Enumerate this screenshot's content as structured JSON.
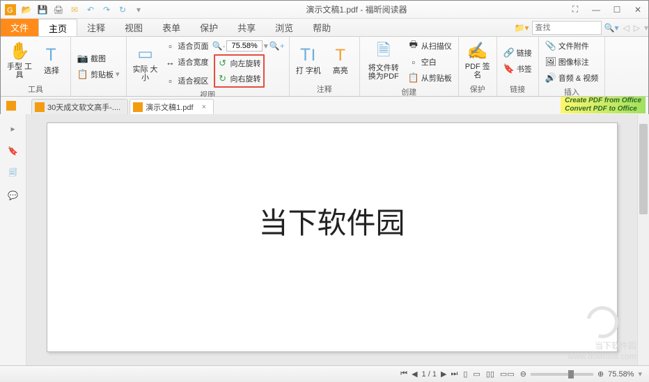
{
  "titlebar": {
    "title": "演示文稿1.pdf - 福昕阅读器"
  },
  "menu": {
    "file": "文件",
    "tabs": [
      "主页",
      "注释",
      "视图",
      "表单",
      "保护",
      "共享",
      "浏览",
      "帮助"
    ],
    "active_index": 0,
    "search_placeholder": "查找"
  },
  "ribbon": {
    "tools": {
      "hand": "手型\n工具",
      "select": "选择",
      "label": "工具"
    },
    "clipboard": {
      "snapshot": "截图",
      "paste": "剪贴板",
      "label": ""
    },
    "view": {
      "actual": "实际\n大小",
      "fitpage": "适合页面",
      "fitwidth": "适合宽度",
      "fitvis": "适合视区",
      "rotateleft": "向左旋转",
      "rotateright": "向右旋转",
      "zoom": "75.58%",
      "label": "视图"
    },
    "comment": {
      "typewriter": "打\n字机",
      "highlight": "高亮",
      "label": "注释"
    },
    "create": {
      "convert": "将文件转\n换为PDF",
      "scanner": "从扫描仪",
      "blank": "空白",
      "clipboard": "从剪贴板",
      "label": "创建"
    },
    "protect": {
      "sign": "PDF\n签名",
      "label": "保护"
    },
    "links": {
      "link": "链接",
      "bookmark": "书签",
      "label": "链接"
    },
    "insert": {
      "attach": "文件附件",
      "image": "图像标注",
      "media": "音频 & 视频",
      "label": "插入"
    }
  },
  "doctabs": [
    {
      "label": "30天成文软文高手-....",
      "active": false
    },
    {
      "label": "演示文稿1.pdf",
      "active": true
    }
  ],
  "banner": {
    "line1": "Create PDF from Office",
    "line2": "Convert PDF to Office"
  },
  "page_content": "当下软件园",
  "status": {
    "page_current": "1",
    "page_total": "1",
    "zoom": "75.58%"
  },
  "watermark": {
    "brand": "当下软件园",
    "url": "www.downxia.com"
  }
}
